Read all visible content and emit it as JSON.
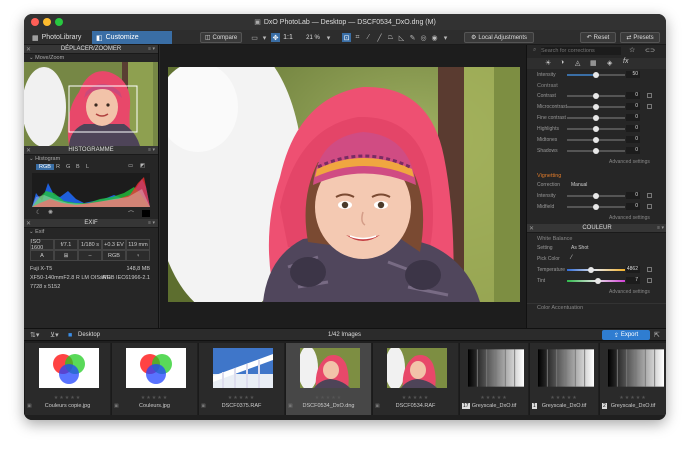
{
  "window": {
    "title": "DxO PhotoLab — Desktop — DSCF0534_DxO.dng (M)"
  },
  "colors": {
    "accent": "#3a6ea5",
    "export": "#2f7dd1",
    "window_bg": "#2a2a2a",
    "panel_bg": "#262626"
  },
  "tabs": [
    {
      "label": "PhotoLibrary"
    },
    {
      "label": "Customize"
    }
  ],
  "toolbar": {
    "compare": "Compare",
    "zoom_ratio": "1:1",
    "zoom_percent": "21 %",
    "local_adjustments": "Local Adjustments",
    "reset": "Reset",
    "presets": "Presets"
  },
  "left": {
    "move_zoom": {
      "header": "DÉPLACER/ZOOMER",
      "sub": "Move/Zoom"
    },
    "histogram": {
      "header": "HISTOGRAMME",
      "sub": "Histogram",
      "channels": [
        "RGB",
        "R",
        "G",
        "B",
        "L"
      ]
    },
    "exif": {
      "header": "EXIF",
      "sub": "Exif",
      "row1": [
        "ISO 1600",
        "f/7.1",
        "1/180 s",
        "+0.3 EV",
        "119 mm"
      ],
      "row2": [
        "A",
        "RGB"
      ],
      "camera": "Fuji X-T5",
      "file_size": "148,8 MB",
      "lens": "XF50-140mmF2.8 R LM OIS WR",
      "colorspace": "sRGB IEC61966-2.1",
      "dimensions": "7728 x 5152"
    }
  },
  "right": {
    "search_placeholder": "Search for corrections",
    "top_slider": {
      "label": "Intensity",
      "value": "50",
      "level": 0.5
    },
    "contrast": {
      "title": "Contrast",
      "rows": [
        {
          "label": "Contrast",
          "value": "0",
          "level": 0.5
        },
        {
          "label": "Microcontrast",
          "value": "0",
          "level": 0.5
        },
        {
          "label": "Fine contrast",
          "value": "0",
          "level": 0.5
        },
        {
          "label": "Highlights",
          "value": "0",
          "level": 0.5
        },
        {
          "label": "Midtones",
          "value": "0",
          "level": 0.5
        },
        {
          "label": "Shadows",
          "value": "0",
          "level": 0.5
        }
      ],
      "advanced": "Advanced settings"
    },
    "vignetting": {
      "title": "Vignetting",
      "correction_label": "Correction",
      "correction_value": "Manual",
      "rows": [
        {
          "label": "Intensity",
          "value": "0",
          "level": 0.5
        },
        {
          "label": "Midfield",
          "value": "0",
          "level": 0.5
        }
      ],
      "advanced": "Advanced settings"
    },
    "color": {
      "header": "COULEUR",
      "white_balance": "White Balance",
      "setting_label": "Setting",
      "setting_value": "As Shot",
      "pick_label": "Pick Color",
      "temperature": {
        "label": "Temperature",
        "value": "4862",
        "level": 0.42
      },
      "tint": {
        "label": "Tint",
        "value": "7",
        "level": 0.54
      },
      "advanced": "Advanced settings",
      "color_accent": "Color Accentuation"
    }
  },
  "bottombar": {
    "folder": "Desktop",
    "count": "1/42 Images",
    "export": "Export"
  },
  "filmstrip": [
    {
      "name": "Couleurs copie.jpg"
    },
    {
      "name": "Couleurs.jpg"
    },
    {
      "name": "DSCF0375.RAF"
    },
    {
      "name": "DSCF0534_DxO.dng"
    },
    {
      "name": "DSCF0534.RAF"
    },
    {
      "name": "Greyscale_DxO.tif",
      "badge": "17"
    },
    {
      "name": "Greyscale_DxO.tif",
      "badge": "1"
    },
    {
      "name": "Greyscale_DxO.tif",
      "badge": "2"
    }
  ]
}
